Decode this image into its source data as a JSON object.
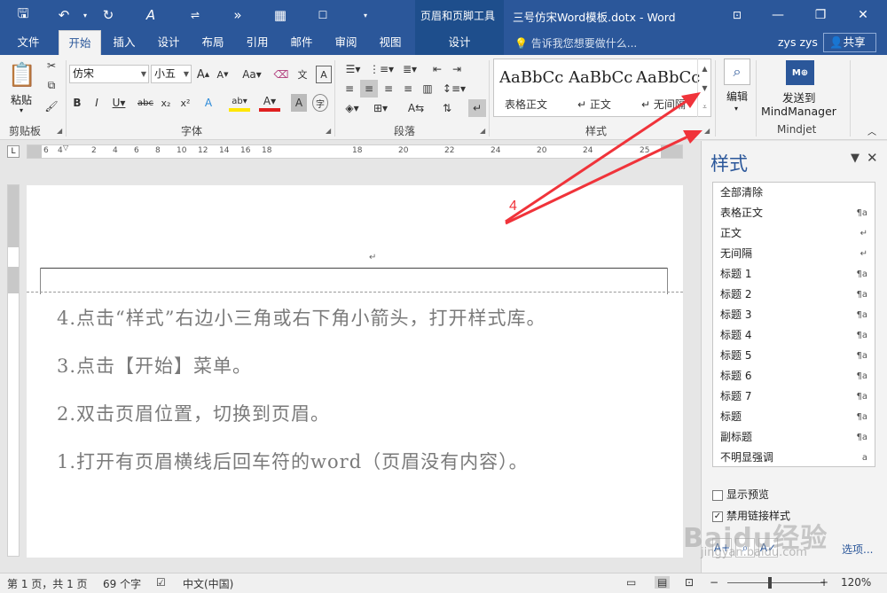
{
  "titlebar": {
    "context_group": "页眉和页脚工具",
    "doc_title": "三号仿宋Word模板.dotx - Word",
    "quick_access": [
      "save-icon",
      "undo-icon",
      "redo-icon",
      "format-painter-icon",
      "fullwidth-icon",
      "forward-icon",
      "table-icon",
      "touch-mode-icon",
      "customize-icon"
    ]
  },
  "tabs": [
    "文件",
    "开始",
    "插入",
    "设计",
    "布局",
    "引用",
    "邮件",
    "审阅",
    "视图"
  ],
  "context_tab": "设计",
  "tell_me": "告诉我您想要做什么...",
  "user": "zys zys",
  "share": "共享",
  "ribbon": {
    "clipboard": {
      "label": "剪贴板",
      "paste": "粘贴"
    },
    "font": {
      "label": "字体",
      "family": "仿宋",
      "size": "小五"
    },
    "paragraph": {
      "label": "段落"
    },
    "styles": {
      "label": "样式",
      "items": [
        {
          "sample": "AaBbCc",
          "name": "表格正文"
        },
        {
          "sample": "AaBbCc",
          "name": "正文"
        },
        {
          "sample": "AaBbCc",
          "name": "无间隔"
        }
      ]
    },
    "editing": {
      "label": "编辑"
    },
    "mindjet": {
      "label": "Mindjet",
      "button": "发送到\nMindManager",
      "line1": "发送到",
      "line2": "MindManager"
    }
  },
  "ruler": {
    "numbers": [
      "6",
      "4",
      "2",
      "",
      "2",
      "4",
      "6",
      "8",
      "10",
      "12",
      "14",
      "16",
      "18",
      "20",
      "22",
      "24",
      "25"
    ]
  },
  "document": {
    "header_mark": "↵",
    "lines": [
      "4.点击“样式”右边小三角或右下角小箭头，打开样式库。",
      "3.点击【开始】菜单。",
      "2.双击页眉位置，切换到页眉。",
      "1.打开有页眉横线后回车符的word（页眉没有内容）。"
    ]
  },
  "annotation": {
    "label": "4",
    "color": "#f0333a"
  },
  "styles_pane": {
    "title": "样式",
    "items": [
      {
        "name": "全部清除",
        "mark": ""
      },
      {
        "name": "表格正文",
        "mark": "¶a"
      },
      {
        "name": "正文",
        "mark": "↵"
      },
      {
        "name": "无间隔",
        "mark": "↵"
      },
      {
        "name": "标题 1",
        "mark": "¶a"
      },
      {
        "name": "标题 2",
        "mark": "¶a"
      },
      {
        "name": "标题 3",
        "mark": "¶a"
      },
      {
        "name": "标题 4",
        "mark": "¶a"
      },
      {
        "name": "标题 5",
        "mark": "¶a"
      },
      {
        "name": "标题 6",
        "mark": "¶a"
      },
      {
        "name": "标题 7",
        "mark": "¶a"
      },
      {
        "name": "标题",
        "mark": "¶a"
      },
      {
        "name": "副标题",
        "mark": "¶a"
      },
      {
        "name": "不明显强调",
        "mark": "a"
      }
    ],
    "show_preview": "显示预览",
    "disable_linked": "禁用链接样式",
    "options": "选项..."
  },
  "status": {
    "page": "第 1 页，共 1 页",
    "words": "69 个字",
    "lang": "中文(中国)",
    "zoom": "120%"
  },
  "watermark": {
    "text": "Baidu经验",
    "url": "jingyan.baidu.com"
  },
  "colors": {
    "accent": "#2b579a",
    "arrow": "#f0333a"
  }
}
